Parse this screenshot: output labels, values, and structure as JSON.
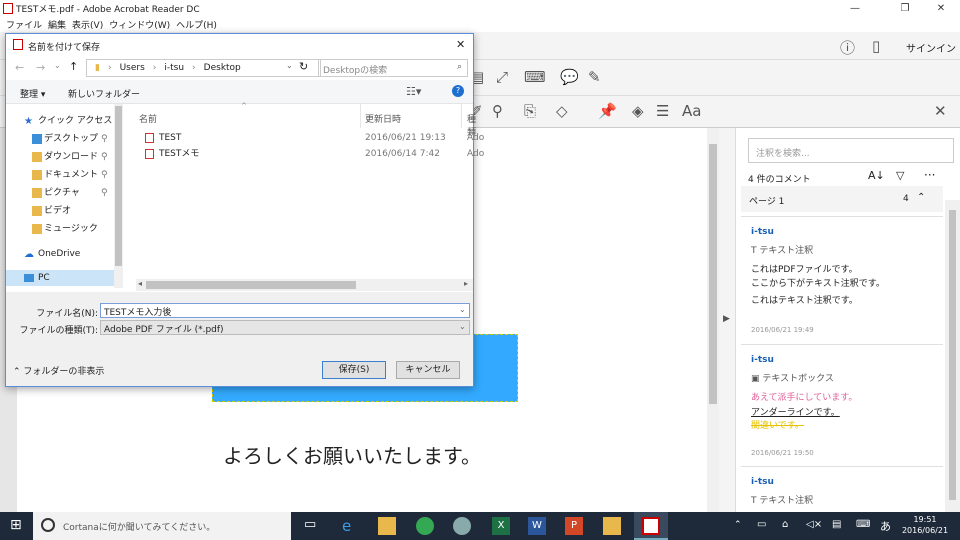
{
  "window": {
    "title": "TESTメモ.pdf - Adobe Acrobat Reader DC",
    "min": "—",
    "max": "❐",
    "close": "✕"
  },
  "menu": [
    "ファイル",
    "編集",
    "表示(V)",
    "ウィンドウ(W)",
    "ヘルプ(H)"
  ],
  "toolbar": {
    "signin": "サインイン"
  },
  "document": {
    "text": "よろしくお願いいたします。"
  },
  "comments_panel": {
    "search_placeholder": "注釈を検索...",
    "count_label": "4 件のコメント",
    "page_label": "ページ 1",
    "page_count": "4",
    "comments": [
      {
        "user": "i-tsu",
        "type": "テキスト注釈",
        "lines": [
          "これはPDFファイルです。",
          "ここから下がテキスト注釈です。",
          "これはテキスト注釈です。"
        ],
        "date": "2016/06/21  19:49"
      },
      {
        "user": "i-tsu",
        "type": "テキストボックス",
        "lines": [
          "あえて派手にしています。",
          "アンダーラインです。",
          "間違いです。"
        ],
        "date": "2016/06/21  19:50"
      },
      {
        "user": "i-tsu",
        "type": "テキスト注釈"
      }
    ]
  },
  "dialog": {
    "title": "名前を付けて保存",
    "breadcrumb": [
      "Users",
      "i-tsu",
      "Desktop"
    ],
    "search_placeholder": "Desktopの検索",
    "organize": "整理",
    "new_folder": "新しいフォルダー",
    "nav_items": [
      "クイック アクセス",
      "デスクトップ",
      "ダウンロード",
      "ドキュメント",
      "ピクチャ",
      "ビデオ",
      "ミュージック",
      "OneDrive",
      "PC"
    ],
    "columns": [
      "名前",
      "更新日時",
      "種類"
    ],
    "files": [
      {
        "name": "TEST",
        "date": "2016/06/21 19:13",
        "type": "Ado"
      },
      {
        "name": "TESTメモ",
        "date": "2016/06/14 7:42",
        "type": "Ado"
      }
    ],
    "filename_label": "ファイル名(N):",
    "filename_value": "TESTメモ入力後",
    "filetype_label": "ファイルの種類(T):",
    "filetype_value": "Adobe PDF ファイル (*.pdf)",
    "hide_folders": "フォルダーの非表示",
    "save": "保存(S)",
    "cancel": "キャンセル"
  },
  "taskbar": {
    "cortana": "Cortanaに何か聞いてみてください。",
    "time": "19:51",
    "date": "2016/06/21",
    "ime": "あ"
  },
  "colors": {
    "highlight_box": "#33aaff",
    "link_user": "#1a5fb4",
    "pink_text": "#e0609a",
    "yellow_strike": "#e6c200"
  }
}
